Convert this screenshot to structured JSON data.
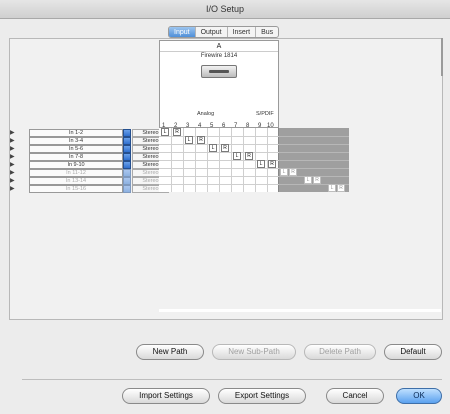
{
  "window": {
    "title": "I/O Setup"
  },
  "tabs": [
    {
      "label": "Input",
      "active": true
    },
    {
      "label": "Output",
      "active": false
    },
    {
      "label": "Insert",
      "active": false
    },
    {
      "label": "Bus",
      "active": false
    }
  ],
  "device": {
    "letter": "A",
    "name": "Firewire 1814",
    "group_analog": "Analog",
    "group_spdif": "S/PDIF",
    "channels": [
      "1",
      "2",
      "3",
      "4",
      "5",
      "6",
      "7",
      "8",
      "9",
      "10"
    ]
  },
  "paths": [
    {
      "name": "In 1-2",
      "format": "Stereo",
      "active": true
    },
    {
      "name": "In 3-4",
      "format": "Stereo",
      "active": true
    },
    {
      "name": "In 5-6",
      "format": "Stereo",
      "active": true
    },
    {
      "name": "In 7-8",
      "format": "Stereo",
      "active": true
    },
    {
      "name": "In 9-10",
      "format": "Stereo",
      "active": true
    },
    {
      "name": "In 11-12",
      "format": "Stereo",
      "active": false
    },
    {
      "name": "In 13-14",
      "format": "Stereo",
      "active": false
    },
    {
      "name": "In 15-16",
      "format": "Stereo",
      "active": false
    }
  ],
  "channel_markers": {
    "left": "L",
    "right": "R"
  },
  "buttons": {
    "new_path": "New Path",
    "new_sub_path": "New Sub-Path",
    "delete_path": "Delete Path",
    "default": "Default",
    "import_settings": "Import Settings",
    "export_settings": "Export Settings",
    "cancel": "Cancel",
    "ok": "OK"
  },
  "colors": {
    "accent": "#4f8fd8",
    "checkbox": "#2f6fcf",
    "unassigned_area": "#9f9f9f"
  }
}
